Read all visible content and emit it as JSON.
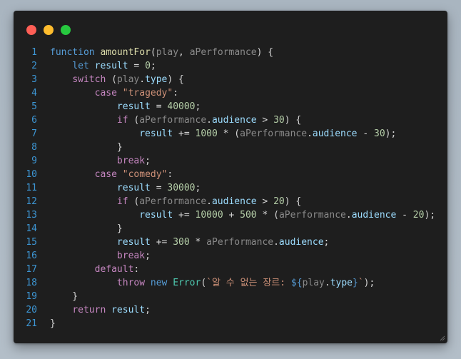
{
  "window": {
    "controls": [
      {
        "name": "close",
        "color": "#ff5f56"
      },
      {
        "name": "minimize",
        "color": "#ffbd2e"
      },
      {
        "name": "maximize",
        "color": "#27c93f"
      }
    ]
  },
  "theme": {
    "background": "#1e1e1e",
    "line_number": "#3d96d4",
    "keyword_blue": "#569cd6",
    "control_purple": "#c586c0",
    "function_yellow": "#dcdcaa",
    "variable_light_blue": "#9cdcfe",
    "param_gray": "#8a8a8a",
    "string_orange": "#ce9178",
    "number_green": "#b5cea8",
    "class_teal": "#4ec9b0",
    "text": "#d4d4d4"
  },
  "code": {
    "lines": [
      {
        "n": "1",
        "tokens": [
          {
            "t": "function",
            "c": "keyword_blue"
          },
          {
            "t": " ",
            "c": "text"
          },
          {
            "t": "amountFor",
            "c": "function_yellow"
          },
          {
            "t": "(",
            "c": "text"
          },
          {
            "t": "play",
            "c": "param_gray"
          },
          {
            "t": ", ",
            "c": "text"
          },
          {
            "t": "aPerformance",
            "c": "param_gray"
          },
          {
            "t": ") {",
            "c": "text"
          }
        ]
      },
      {
        "n": "2",
        "tokens": [
          {
            "t": "    ",
            "c": "text"
          },
          {
            "t": "let",
            "c": "keyword_blue"
          },
          {
            "t": " ",
            "c": "text"
          },
          {
            "t": "result",
            "c": "variable_light_blue"
          },
          {
            "t": " = ",
            "c": "text"
          },
          {
            "t": "0",
            "c": "number_green"
          },
          {
            "t": ";",
            "c": "text"
          }
        ]
      },
      {
        "n": "3",
        "tokens": [
          {
            "t": "    ",
            "c": "text"
          },
          {
            "t": "switch",
            "c": "control_purple"
          },
          {
            "t": " (",
            "c": "text"
          },
          {
            "t": "play",
            "c": "param_gray"
          },
          {
            "t": ".",
            "c": "text"
          },
          {
            "t": "type",
            "c": "variable_light_blue"
          },
          {
            "t": ") {",
            "c": "text"
          }
        ]
      },
      {
        "n": "4",
        "tokens": [
          {
            "t": "        ",
            "c": "text"
          },
          {
            "t": "case",
            "c": "control_purple"
          },
          {
            "t": " ",
            "c": "text"
          },
          {
            "t": "\"tragedy\"",
            "c": "string_orange"
          },
          {
            "t": ":",
            "c": "text"
          }
        ]
      },
      {
        "n": "5",
        "tokens": [
          {
            "t": "            ",
            "c": "text"
          },
          {
            "t": "result",
            "c": "variable_light_blue"
          },
          {
            "t": " = ",
            "c": "text"
          },
          {
            "t": "40000",
            "c": "number_green"
          },
          {
            "t": ";",
            "c": "text"
          }
        ]
      },
      {
        "n": "6",
        "tokens": [
          {
            "t": "            ",
            "c": "text"
          },
          {
            "t": "if",
            "c": "control_purple"
          },
          {
            "t": " (",
            "c": "text"
          },
          {
            "t": "aPerformance",
            "c": "param_gray"
          },
          {
            "t": ".",
            "c": "text"
          },
          {
            "t": "audience",
            "c": "variable_light_blue"
          },
          {
            "t": " > ",
            "c": "text"
          },
          {
            "t": "30",
            "c": "number_green"
          },
          {
            "t": ") {",
            "c": "text"
          }
        ]
      },
      {
        "n": "7",
        "tokens": [
          {
            "t": "                ",
            "c": "text"
          },
          {
            "t": "result",
            "c": "variable_light_blue"
          },
          {
            "t": " += ",
            "c": "text"
          },
          {
            "t": "1000",
            "c": "number_green"
          },
          {
            "t": " * (",
            "c": "text"
          },
          {
            "t": "aPerformance",
            "c": "param_gray"
          },
          {
            "t": ".",
            "c": "text"
          },
          {
            "t": "audience",
            "c": "variable_light_blue"
          },
          {
            "t": " - ",
            "c": "text"
          },
          {
            "t": "30",
            "c": "number_green"
          },
          {
            "t": ");",
            "c": "text"
          }
        ]
      },
      {
        "n": "8",
        "tokens": [
          {
            "t": "            }",
            "c": "text"
          }
        ]
      },
      {
        "n": "9",
        "tokens": [
          {
            "t": "            ",
            "c": "text"
          },
          {
            "t": "break",
            "c": "control_purple"
          },
          {
            "t": ";",
            "c": "text"
          }
        ]
      },
      {
        "n": "10",
        "tokens": [
          {
            "t": "        ",
            "c": "text"
          },
          {
            "t": "case",
            "c": "control_purple"
          },
          {
            "t": " ",
            "c": "text"
          },
          {
            "t": "\"comedy\"",
            "c": "string_orange"
          },
          {
            "t": ":",
            "c": "text"
          }
        ]
      },
      {
        "n": "11",
        "tokens": [
          {
            "t": "            ",
            "c": "text"
          },
          {
            "t": "result",
            "c": "variable_light_blue"
          },
          {
            "t": " = ",
            "c": "text"
          },
          {
            "t": "30000",
            "c": "number_green"
          },
          {
            "t": ";",
            "c": "text"
          }
        ]
      },
      {
        "n": "12",
        "tokens": [
          {
            "t": "            ",
            "c": "text"
          },
          {
            "t": "if",
            "c": "control_purple"
          },
          {
            "t": " (",
            "c": "text"
          },
          {
            "t": "aPerformance",
            "c": "param_gray"
          },
          {
            "t": ".",
            "c": "text"
          },
          {
            "t": "audience",
            "c": "variable_light_blue"
          },
          {
            "t": " > ",
            "c": "text"
          },
          {
            "t": "20",
            "c": "number_green"
          },
          {
            "t": ") {",
            "c": "text"
          }
        ]
      },
      {
        "n": "13",
        "tokens": [
          {
            "t": "                ",
            "c": "text"
          },
          {
            "t": "result",
            "c": "variable_light_blue"
          },
          {
            "t": " += ",
            "c": "text"
          },
          {
            "t": "10000",
            "c": "number_green"
          },
          {
            "t": " + ",
            "c": "text"
          },
          {
            "t": "500",
            "c": "number_green"
          },
          {
            "t": " * (",
            "c": "text"
          },
          {
            "t": "aPerformance",
            "c": "param_gray"
          },
          {
            "t": ".",
            "c": "text"
          },
          {
            "t": "audience",
            "c": "variable_light_blue"
          },
          {
            "t": " - ",
            "c": "text"
          },
          {
            "t": "20",
            "c": "number_green"
          },
          {
            "t": ");",
            "c": "text"
          }
        ]
      },
      {
        "n": "14",
        "tokens": [
          {
            "t": "            }",
            "c": "text"
          }
        ]
      },
      {
        "n": "15",
        "tokens": [
          {
            "t": "            ",
            "c": "text"
          },
          {
            "t": "result",
            "c": "variable_light_blue"
          },
          {
            "t": " += ",
            "c": "text"
          },
          {
            "t": "300",
            "c": "number_green"
          },
          {
            "t": " * ",
            "c": "text"
          },
          {
            "t": "aPerformance",
            "c": "param_gray"
          },
          {
            "t": ".",
            "c": "text"
          },
          {
            "t": "audience",
            "c": "variable_light_blue"
          },
          {
            "t": ";",
            "c": "text"
          }
        ]
      },
      {
        "n": "16",
        "tokens": [
          {
            "t": "            ",
            "c": "text"
          },
          {
            "t": "break",
            "c": "control_purple"
          },
          {
            "t": ";",
            "c": "text"
          }
        ]
      },
      {
        "n": "17",
        "tokens": [
          {
            "t": "        ",
            "c": "text"
          },
          {
            "t": "default",
            "c": "control_purple"
          },
          {
            "t": ":",
            "c": "text"
          }
        ]
      },
      {
        "n": "18",
        "tokens": [
          {
            "t": "            ",
            "c": "text"
          },
          {
            "t": "throw",
            "c": "control_purple"
          },
          {
            "t": " ",
            "c": "text"
          },
          {
            "t": "new",
            "c": "keyword_blue"
          },
          {
            "t": " ",
            "c": "text"
          },
          {
            "t": "Error",
            "c": "class_teal"
          },
          {
            "t": "(",
            "c": "text"
          },
          {
            "t": "`알 수 없는 장르: ",
            "c": "string_orange"
          },
          {
            "t": "${",
            "c": "keyword_blue"
          },
          {
            "t": "play",
            "c": "param_gray"
          },
          {
            "t": ".",
            "c": "text"
          },
          {
            "t": "type",
            "c": "variable_light_blue"
          },
          {
            "t": "}",
            "c": "keyword_blue"
          },
          {
            "t": "`",
            "c": "string_orange"
          },
          {
            "t": ");",
            "c": "text"
          }
        ]
      },
      {
        "n": "19",
        "tokens": [
          {
            "t": "    }",
            "c": "text"
          }
        ]
      },
      {
        "n": "20",
        "tokens": [
          {
            "t": "    ",
            "c": "text"
          },
          {
            "t": "return",
            "c": "control_purple"
          },
          {
            "t": " ",
            "c": "text"
          },
          {
            "t": "result",
            "c": "variable_light_blue"
          },
          {
            "t": ";",
            "c": "text"
          }
        ]
      },
      {
        "n": "21",
        "tokens": [
          {
            "t": "}",
            "c": "text"
          }
        ]
      }
    ]
  }
}
